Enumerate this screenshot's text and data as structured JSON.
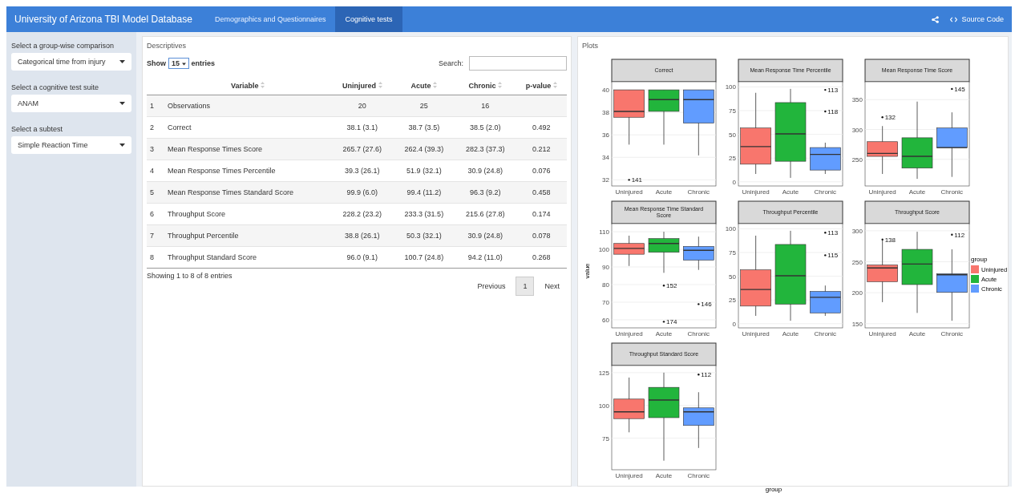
{
  "navbar": {
    "title": "University of Arizona TBI Model Database",
    "tabs": [
      {
        "label": "Demographics and Questionnaires",
        "selected": false
      },
      {
        "label": "Cognitive tests",
        "selected": true
      }
    ],
    "source_link": "Source Code"
  },
  "sidebar": {
    "inputs": [
      {
        "label": "Select a group-wise comparison",
        "value": "Categorical time from injury"
      },
      {
        "label": "Select a cognitive test suite",
        "value": "ANAM"
      },
      {
        "label": "Select a subtest",
        "value": "Simple Reaction Time"
      }
    ]
  },
  "descriptives": {
    "title": "Descriptives",
    "show_label": "Show",
    "page_size": "15",
    "entries_label": "entries",
    "search_label": "Search:",
    "columns": [
      "",
      "Variable",
      "Uninjured",
      "Acute",
      "Chronic",
      "p-value"
    ],
    "rows": [
      [
        "1",
        "Observations",
        "20",
        "25",
        "16",
        ""
      ],
      [
        "2",
        "Correct",
        "38.1 (3.1)",
        "38.7 (3.5)",
        "38.5 (2.0)",
        "0.492"
      ],
      [
        "3",
        "Mean Response Times Score",
        "265.7 (27.6)",
        "262.4 (39.3)",
        "282.3 (37.3)",
        "0.212"
      ],
      [
        "4",
        "Mean Response Times Percentile",
        "39.3 (26.1)",
        "51.9 (32.1)",
        "30.9 (24.8)",
        "0.076"
      ],
      [
        "5",
        "Mean Response Times Standard Score",
        "99.9 (6.0)",
        "99.4 (11.2)",
        "96.3 (9.2)",
        "0.458"
      ],
      [
        "6",
        "Throughput Score",
        "228.2 (23.2)",
        "233.3 (31.5)",
        "215.6 (27.8)",
        "0.174"
      ],
      [
        "7",
        "Throughput Percentile",
        "38.8 (26.1)",
        "50.3 (32.1)",
        "30.9 (24.8)",
        "0.078"
      ],
      [
        "8",
        "Throughput Standard Score",
        "96.0 (9.1)",
        "100.7 (24.8)",
        "94.2 (11.0)",
        "0.268"
      ]
    ],
    "info": "Showing 1 to 8 of 8 entries",
    "pager": [
      {
        "label": "Previous",
        "selected": false
      },
      {
        "label": "1",
        "selected": true
      },
      {
        "label": "Next",
        "selected": false
      }
    ]
  },
  "plots": {
    "title": "Plots",
    "ylabel": "value",
    "xlabel": "group",
    "facets": [
      {
        "title": "Correct",
        "ticks": [
          "40",
          "38",
          "36",
          "34",
          "32"
        ],
        "categories": [
          "Uninjured",
          "Acute",
          "Chronic"
        ],
        "outliers": [
          "141"
        ]
      },
      {
        "title": "Mean Response Time Percentile",
        "ticks": [
          "100",
          "75",
          "50",
          "25",
          "0"
        ],
        "categories": [
          "Uninjured",
          "Acute",
          "Chronic"
        ],
        "outliers": [
          "113",
          "118"
        ]
      },
      {
        "title": "Mean Response Time Score",
        "ticks": [
          "350",
          "300",
          "250"
        ],
        "categories": [
          "Uninjured",
          "Acute",
          "Chronic"
        ],
        "outliers": [
          "145",
          "132"
        ]
      },
      {
        "title": "Mean Response Time Standard Score",
        "ticks": [
          "110",
          "100",
          "90",
          "80",
          "70",
          "60"
        ],
        "categories": [
          "Uninjured",
          "Acute",
          "Chronic"
        ],
        "outliers": [
          "152",
          "174",
          "146"
        ]
      },
      {
        "title": "Throughput Percentile",
        "ticks": [
          "100",
          "75",
          "50",
          "25",
          "0"
        ],
        "categories": [
          "Uninjured",
          "Acute",
          "Chronic"
        ],
        "outliers": [
          "113",
          "115"
        ]
      },
      {
        "title": "Throughput Score",
        "ticks": [
          "300",
          "250",
          "200",
          "150"
        ],
        "categories": [
          "Uninjured",
          "Acute",
          "Chronic"
        ],
        "outliers": [
          "138",
          "112"
        ]
      },
      {
        "title": "Throughput Standard Score",
        "ticks": [
          "125",
          "100",
          "75"
        ],
        "categories": [
          "Uninjured",
          "Acute",
          "Chronic"
        ],
        "outliers": [
          "112"
        ]
      }
    ],
    "legend": {
      "title": "group",
      "items": [
        {
          "label": "Uninjured",
          "color": "#f8766d"
        },
        {
          "label": "Acute",
          "color": "#22b53c"
        },
        {
          "label": "Chronic",
          "color": "#619cff"
        }
      ]
    }
  }
}
